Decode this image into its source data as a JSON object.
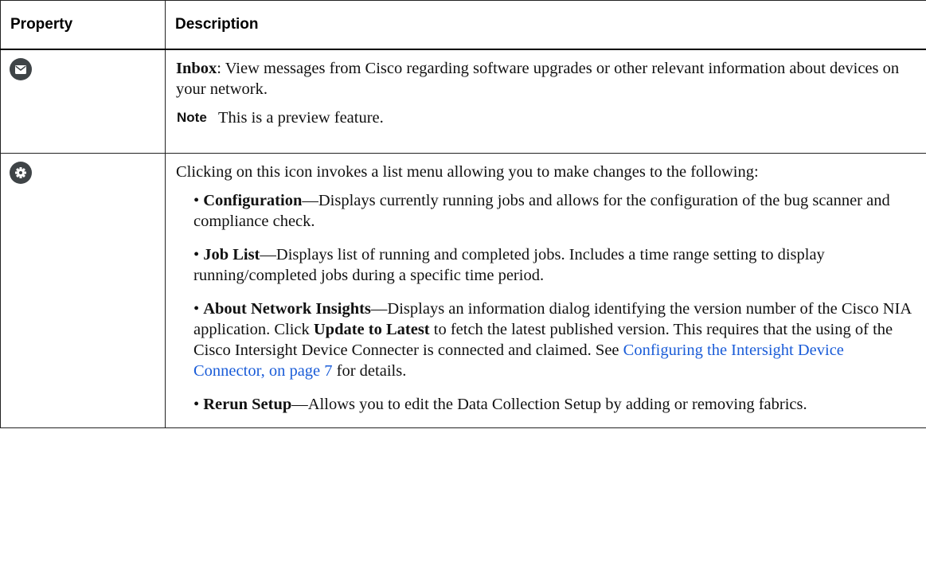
{
  "table": {
    "headers": {
      "property": "Property",
      "description": "Description"
    },
    "rows": [
      {
        "icon": "envelope-icon",
        "title": "Inbox",
        "text": ": View messages from Cisco regarding software upgrades or other relevant information about devices on your network.",
        "note_label": "Note",
        "note_text": "This is a preview feature."
      },
      {
        "icon": "gear-icon",
        "intro": "Clicking on this icon invokes a list menu allowing you to make changes to the following:",
        "bullet": "•",
        "items": [
          {
            "term": "Configuration",
            "text": "—Displays currently running jobs and allows for the configuration of the bug scanner and compliance check."
          },
          {
            "term": "Job List",
            "text": "—Displays list of running and completed jobs. Includes a time range setting to display running/completed jobs during a specific time period."
          },
          {
            "term": "About Network Insights",
            "text_a": "—Displays an information dialog identifying the version number of the Cisco NIA application. Click ",
            "bold_b": "Update to Latest",
            "text_c": " to fetch the latest published version. This requires that the using of the Cisco Intersight Device Connecter is connected and claimed. See ",
            "link": "Configuring the Intersight Device Connector, on page 7",
            "text_d": " for details."
          },
          {
            "term": "Rerun Setup",
            "text": "—Allows you to edit the Data Collection Setup by adding or removing fabrics."
          }
        ]
      }
    ]
  },
  "colors": {
    "icon_bg": "#3f4447",
    "link": "#1a5cd8"
  }
}
